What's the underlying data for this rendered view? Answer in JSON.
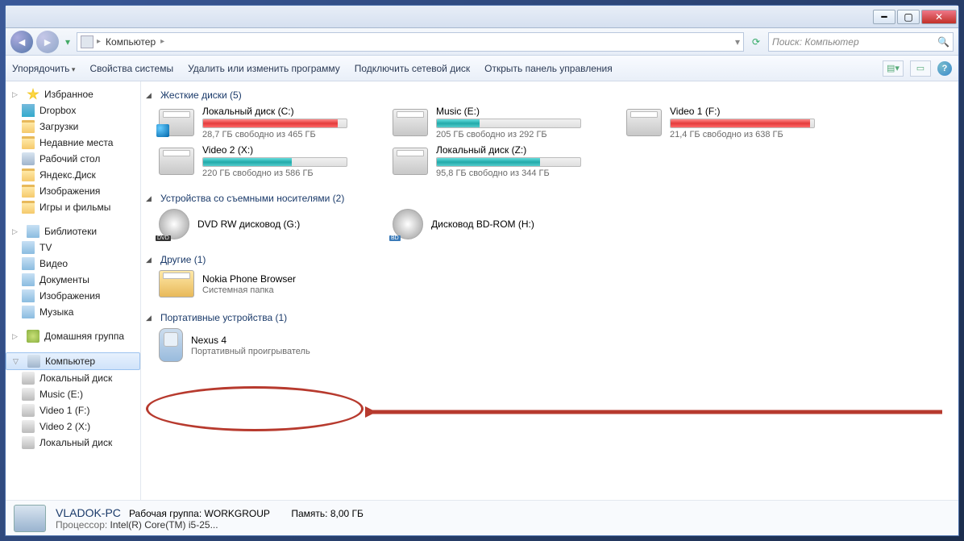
{
  "titlebar": {
    "min": "━",
    "max": "▢",
    "close": "✕"
  },
  "nav": {
    "breadcrumb": {
      "root_arrow": "▸",
      "location": "Компьютер",
      "sep": "▸"
    },
    "search_placeholder": "Поиск: Компьютер"
  },
  "toolbar": {
    "organize": "Упорядочить",
    "properties": "Свойства системы",
    "uninstall": "Удалить или изменить программу",
    "mapdrive": "Подключить сетевой диск",
    "controlpanel": "Открыть панель управления"
  },
  "sidebar": {
    "favorites": "Избранное",
    "fav_items": [
      "Dropbox",
      "Загрузки",
      "Недавние места",
      "Рабочий стол",
      "Яндекс.Диск",
      "Изображения",
      "Игры и фильмы"
    ],
    "libraries": "Библиотеки",
    "lib_items": [
      "TV",
      "Видео",
      "Документы",
      "Изображения",
      "Музыка"
    ],
    "homegroup": "Домашняя группа",
    "computer": "Компьютер",
    "comp_items": [
      "Локальный диск",
      "Music (E:)",
      "Video 1 (F:)",
      "Video 2 (X:)",
      "Локальный диск"
    ]
  },
  "sections": {
    "hdd": {
      "title": "Жесткие диски (5)"
    },
    "removable": {
      "title": "Устройства со съемными носителями (2)"
    },
    "other": {
      "title": "Другие (1)"
    },
    "portable": {
      "title": "Портативные устройства (1)"
    }
  },
  "drives": {
    "c": {
      "name": "Локальный диск (C:)",
      "sub": "28,7 ГБ свободно из 465 ГБ",
      "fill": 94,
      "color": "red"
    },
    "e": {
      "name": "Music (E:)",
      "sub": "205 ГБ свободно из 292 ГБ",
      "fill": 30,
      "color": "teal"
    },
    "f": {
      "name": "Video 1 (F:)",
      "sub": "21,4 ГБ свободно из 638 ГБ",
      "fill": 97,
      "color": "red"
    },
    "x": {
      "name": "Video 2 (X:)",
      "sub": "220 ГБ свободно из 586 ГБ",
      "fill": 62,
      "color": "teal"
    },
    "z": {
      "name": "Локальный диск (Z:)",
      "sub": "95,8 ГБ свободно из 344 ГБ",
      "fill": 72,
      "color": "teal"
    }
  },
  "removable": {
    "dvd": {
      "name": "DVD RW дисковод (G:)",
      "badge": "DVD"
    },
    "bd": {
      "name": "Дисковод BD-ROM (H:)",
      "badge": "BD"
    }
  },
  "other": {
    "nokia": {
      "name": "Nokia Phone Browser",
      "sub": "Системная папка"
    }
  },
  "portable": {
    "nexus": {
      "name": "Nexus 4",
      "sub": "Портативный проигрыватель"
    }
  },
  "status": {
    "pcname": "VLADOK-PC",
    "workgroup_lbl": "Рабочая группа:",
    "workgroup_val": "WORKGROUP",
    "mem_lbl": "Память:",
    "mem_val": "8,00 ГБ",
    "cpu_lbl": "Процессор:",
    "cpu_val": "Intel(R) Core(TM) i5-25..."
  }
}
